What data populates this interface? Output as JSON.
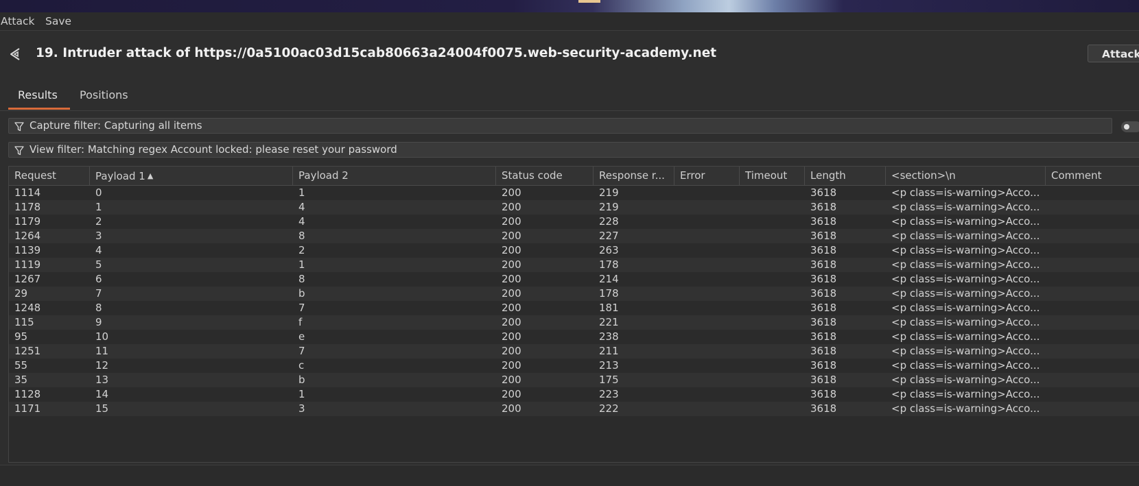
{
  "menu": {
    "items": [
      "Attack",
      "Save"
    ]
  },
  "header": {
    "title": "19. Intruder attack of https://0a5100ac03d15cab80663a24004f0075.web-security-academy.net",
    "attack_button": "Attack",
    "back_icon": "back-arrow-icon"
  },
  "tabs": [
    {
      "label": "Results",
      "active": true
    },
    {
      "label": "Positions",
      "active": false
    }
  ],
  "filters": {
    "capture": "Capture filter: Capturing all items",
    "view": "View filter: Matching regex Account locked: please reset your password"
  },
  "table": {
    "columns": [
      "Request",
      "Payload 1",
      "Payload 2",
      "Status code",
      "Response r...",
      "Error",
      "Timeout",
      "Length",
      "<section>\\n",
      "Comment"
    ],
    "sorted_column": "Payload 1",
    "sort_direction": "ascending",
    "rows": [
      [
        "1114",
        "0",
        "1",
        "200",
        "219",
        "",
        "",
        "3618",
        "<p class=is-warning>Acco...",
        ""
      ],
      [
        "1178",
        "1",
        "4",
        "200",
        "219",
        "",
        "",
        "3618",
        "<p class=is-warning>Acco...",
        ""
      ],
      [
        "1179",
        "2",
        "4",
        "200",
        "228",
        "",
        "",
        "3618",
        "<p class=is-warning>Acco...",
        ""
      ],
      [
        "1264",
        "3",
        "8",
        "200",
        "227",
        "",
        "",
        "3618",
        "<p class=is-warning>Acco...",
        ""
      ],
      [
        "1139",
        "4",
        "2",
        "200",
        "263",
        "",
        "",
        "3618",
        "<p class=is-warning>Acco...",
        ""
      ],
      [
        "1119",
        "5",
        "1",
        "200",
        "178",
        "",
        "",
        "3618",
        "<p class=is-warning>Acco...",
        ""
      ],
      [
        "1267",
        "6",
        "8",
        "200",
        "214",
        "",
        "",
        "3618",
        "<p class=is-warning>Acco...",
        ""
      ],
      [
        "29",
        "7",
        "b",
        "200",
        "178",
        "",
        "",
        "3618",
        "<p class=is-warning>Acco...",
        ""
      ],
      [
        "1248",
        "8",
        "7",
        "200",
        "181",
        "",
        "",
        "3618",
        "<p class=is-warning>Acco...",
        ""
      ],
      [
        "115",
        "9",
        "f",
        "200",
        "221",
        "",
        "",
        "3618",
        "<p class=is-warning>Acco...",
        ""
      ],
      [
        "95",
        "10",
        "e",
        "200",
        "238",
        "",
        "",
        "3618",
        "<p class=is-warning>Acco...",
        ""
      ],
      [
        "1251",
        "11",
        "7",
        "200",
        "211",
        "",
        "",
        "3618",
        "<p class=is-warning>Acco...",
        ""
      ],
      [
        "55",
        "12",
        "c",
        "200",
        "213",
        "",
        "",
        "3618",
        "<p class=is-warning>Acco...",
        ""
      ],
      [
        "35",
        "13",
        "b",
        "200",
        "175",
        "",
        "",
        "3618",
        "<p class=is-warning>Acco...",
        ""
      ],
      [
        "1128",
        "14",
        "1",
        "200",
        "223",
        "",
        "",
        "3618",
        "<p class=is-warning>Acco...",
        ""
      ],
      [
        "1171",
        "15",
        "3",
        "200",
        "222",
        "",
        "",
        "3618",
        "<p class=is-warning>Acco...",
        ""
      ]
    ]
  },
  "colors": {
    "background": "#2e2e2e",
    "tab_accent": "#d96b3a",
    "text": "#d7d7d7"
  }
}
